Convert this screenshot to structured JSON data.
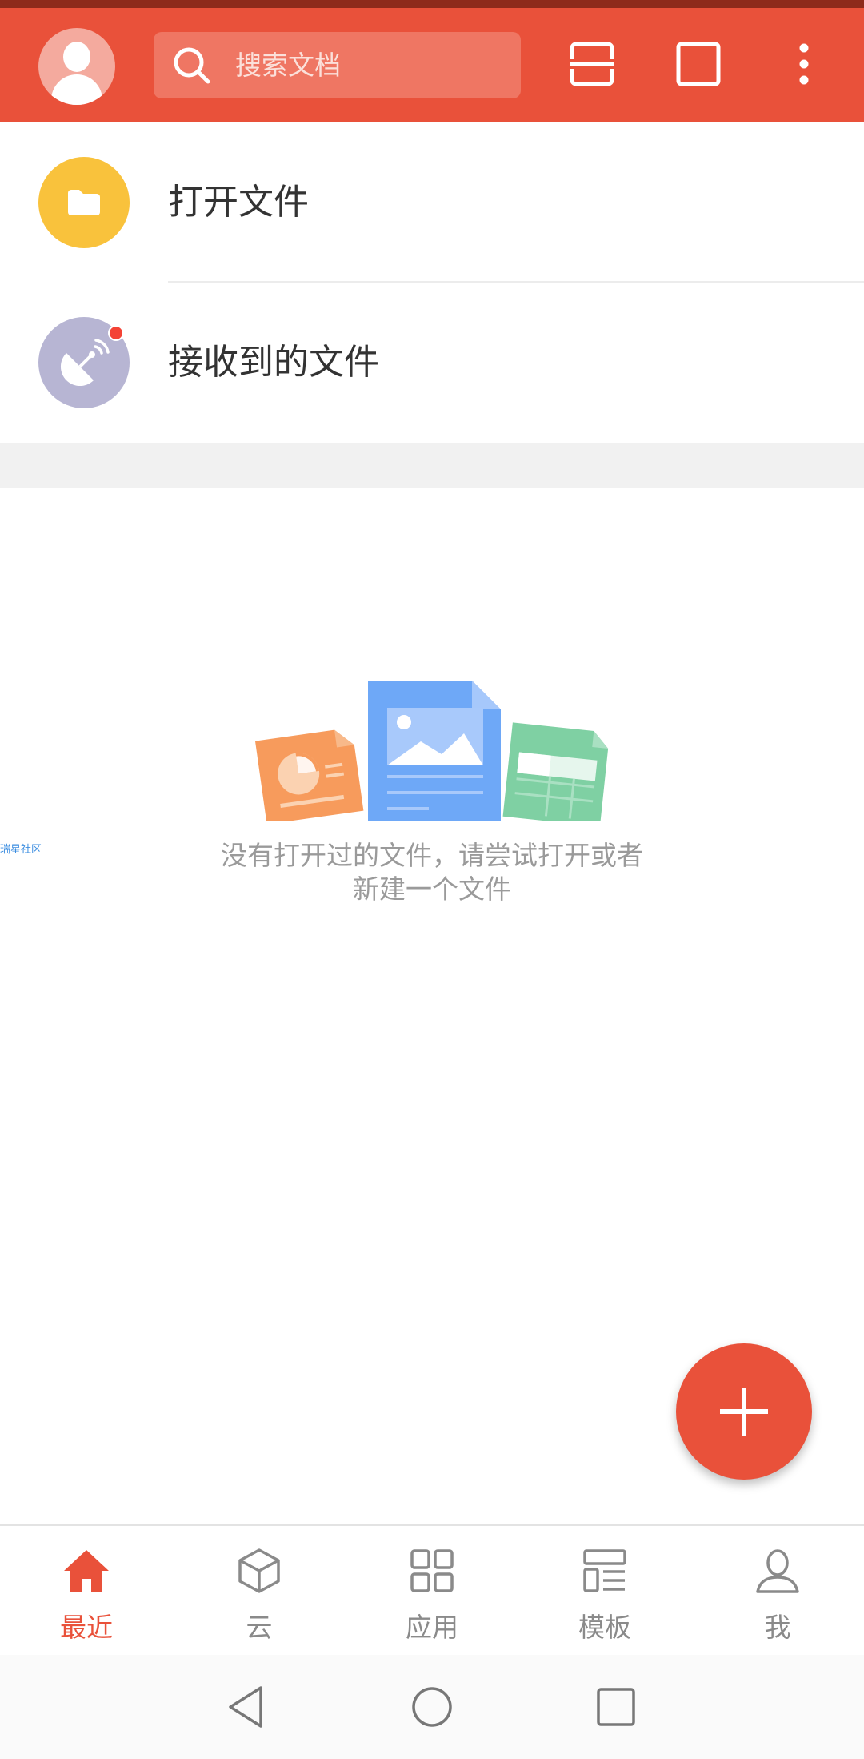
{
  "header": {
    "search_placeholder": "搜索文档"
  },
  "quick_actions": [
    {
      "label": "打开文件",
      "color": "#f9c23c",
      "icon": "folder-icon"
    },
    {
      "label": "接收到的文件",
      "color": "#b7b5d3",
      "icon": "satellite-dish-icon",
      "has_unread": true
    }
  ],
  "empty_state": {
    "line1": "没有打开过的文件，请尝试打开或者",
    "line2": "新建一个文件"
  },
  "watermark": "瑞星社区",
  "bottom_nav": {
    "items": [
      {
        "label": "最近",
        "icon": "home-icon",
        "active": true
      },
      {
        "label": "云",
        "icon": "cube-icon",
        "active": false
      },
      {
        "label": "应用",
        "icon": "apps-grid-icon",
        "active": false
      },
      {
        "label": "模板",
        "icon": "template-icon",
        "active": false
      },
      {
        "label": "我",
        "icon": "person-icon",
        "active": false
      }
    ]
  },
  "colors": {
    "accent": "#e9513a",
    "folder": "#f9c23c",
    "received": "#b7b5d3"
  }
}
